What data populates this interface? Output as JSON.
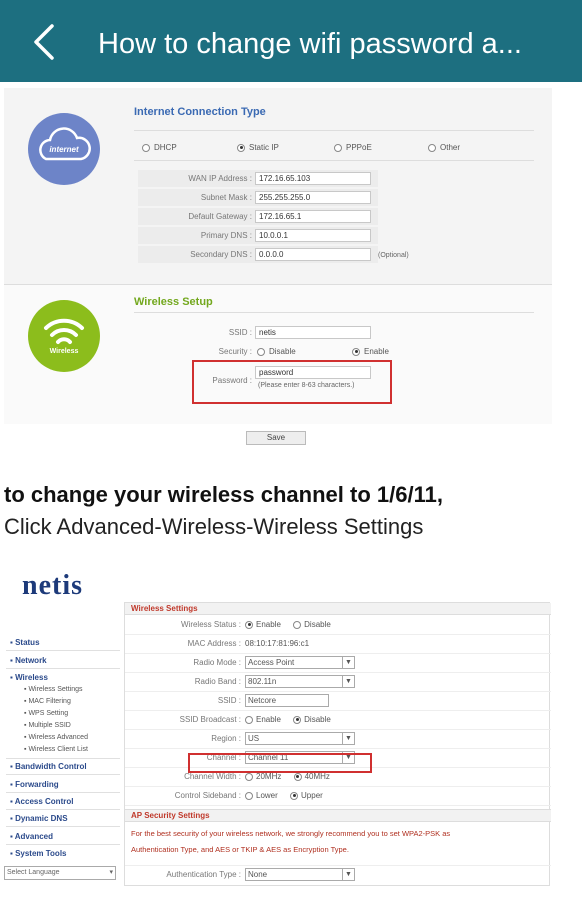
{
  "appbar": {
    "title": "How to change wifi password a...",
    "back_icon": "chevron-left-icon",
    "background": "#1d6f80"
  },
  "screenshot1": {
    "internet_icon_label": "internet",
    "wireless_icon_label": "Wireless",
    "connection_title": "Internet Connection Type",
    "connection_options": [
      "DHCP",
      "Static IP",
      "PPPoE",
      "Other"
    ],
    "connection_selected": "Static IP",
    "fields": [
      {
        "label": "WAN IP Address :",
        "value": "172.16.65.103"
      },
      {
        "label": "Subnet Mask :",
        "value": "255.255.255.0"
      },
      {
        "label": "Default Gateway :",
        "value": "172.16.65.1"
      },
      {
        "label": "Primary DNS :",
        "value": "10.0.0.1"
      },
      {
        "label": "Secondary DNS :",
        "value": "0.0.0.0"
      }
    ],
    "optional_hint": "(Optional)",
    "wireless_title": "Wireless Setup",
    "ssid_label": "SSID :",
    "ssid_value": "netis",
    "security_label": "Security :",
    "security_options": [
      "Disable",
      "Enable"
    ],
    "security_selected": "Enable",
    "password_label": "Password :",
    "password_value": "password",
    "password_hint": "(Please enter 8-63 characters.)",
    "save_label": "Save"
  },
  "instructions": {
    "line1": "to change your wireless channel to 1/6/11,",
    "line2": "Click Advanced-Wireless-Wireless Settings"
  },
  "screenshot2": {
    "logo": "netis",
    "sidebar": {
      "items": [
        {
          "label": "Status"
        },
        {
          "label": "Network"
        },
        {
          "label": "Wireless"
        },
        {
          "label": "Bandwidth Control"
        },
        {
          "label": "Forwarding"
        },
        {
          "label": "Access Control"
        },
        {
          "label": "Dynamic DNS"
        },
        {
          "label": "Advanced"
        },
        {
          "label": "System Tools"
        }
      ],
      "wireless_sub": [
        "Wireless Settings",
        "MAC Filtering",
        "WPS Setting",
        "Multiple SSID",
        "Wireless Advanced",
        "Wireless Client List"
      ],
      "language": "Select Language"
    },
    "section_title": "Wireless Settings",
    "rows": {
      "status_label": "Wireless Status :",
      "status_options": [
        "Enable",
        "Disable"
      ],
      "mac_label": "MAC Address :",
      "mac_value": "08:10:17:81:96:c1",
      "mode_label": "Radio Mode :",
      "mode_value": "Access Point",
      "band_label": "Radio Band :",
      "band_value": "802.11n",
      "ssid_label": "SSID :",
      "ssid_value": "Netcore",
      "broadcast_label": "SSID Broadcast :",
      "broadcast_options": [
        "Enable",
        "Disable"
      ],
      "region_label": "Region :",
      "region_value": "US",
      "channel_label": "Channel :",
      "channel_value": "Channel 11",
      "width_label": "Channel Width :",
      "width_options": [
        "20MHz",
        "40MHz"
      ],
      "sideband_label": "Control Sideband :",
      "sideband_options": [
        "Lower",
        "Upper"
      ]
    },
    "ap_title": "AP Security Settings",
    "warning_line1": "For the best security of your wireless network, we strongly recommend you to set WPA2-PSK as",
    "warning_line2": "Authentication Type, and AES or TKIP & AES as Encryption Type.",
    "auth_label": "Authentication Type :",
    "auth_value": "None"
  }
}
